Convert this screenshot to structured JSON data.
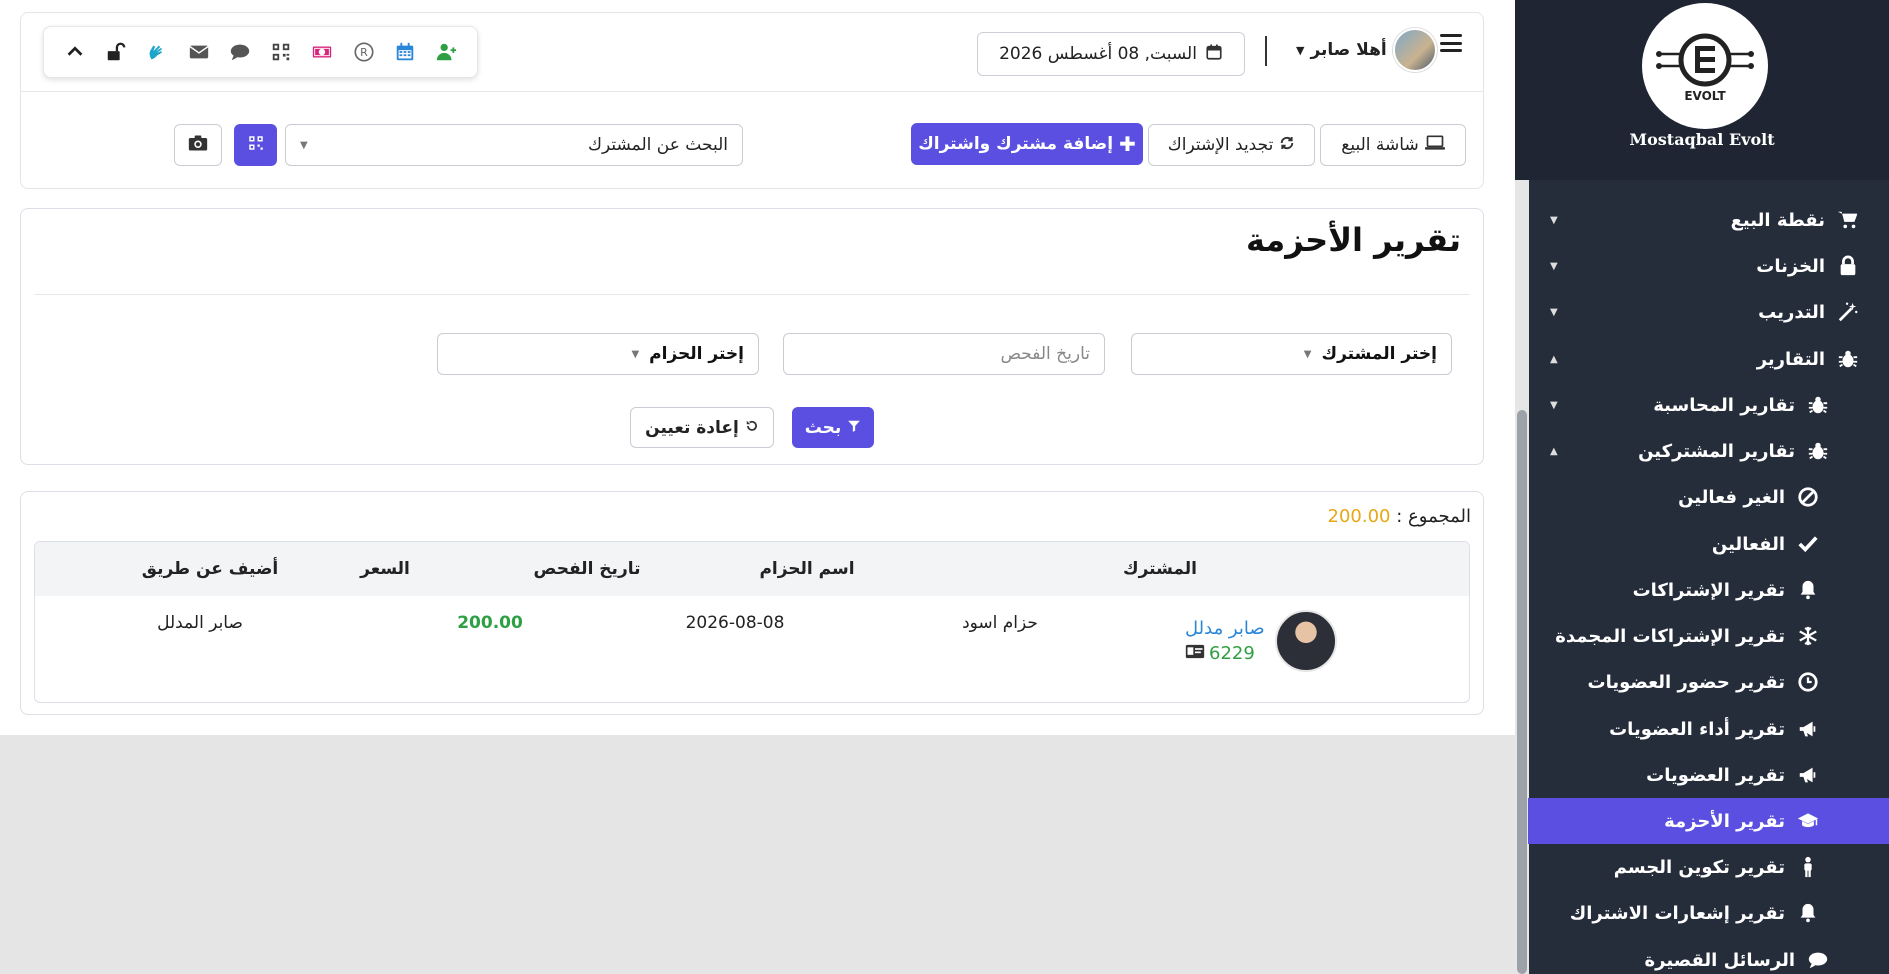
{
  "toolbar": {
    "icons": [
      "add-user-icon",
      "calendar-icon",
      "registered-icon",
      "money-icon",
      "qr-code-icon",
      "chat-icon",
      "envelope-icon",
      "sign-language-icon",
      "unlock-icon",
      "chevron-up-icon"
    ]
  },
  "header": {
    "date": "السبت, 08 أغسطس 2026",
    "user_greeting": "أهلا صابر"
  },
  "actions": {
    "pos_screen": "شاشة البيع",
    "renew_subscription": "تجديد الإشتراك",
    "add_member": "إضافة مشترك واشتراك",
    "search_placeholder": "البحث عن المشترك"
  },
  "report": {
    "title": "تقرير الأحزمة",
    "filters": {
      "member_select": "إختر المشترك",
      "exam_date_placeholder": "تاريخ الفحص",
      "belt_select": "إختر الحزام"
    },
    "search_button": "بحث",
    "reset_button": "إعادة تعيين",
    "total_label": "المجموع :",
    "total_value": "200.00",
    "columns": [
      "المشترك",
      "اسم الحزام",
      "تاريخ الفحص",
      "السعر",
      "أضيف عن طريق"
    ],
    "rows": [
      {
        "member_name": "صابر مدلل",
        "member_id": "6229",
        "belt": "حزام اسود",
        "exam_date": "2026-08-08",
        "price": "200.00",
        "added_by": "صابر المدلل"
      }
    ]
  },
  "sidebar": {
    "brand": "Mostaqbal Evolt",
    "logo_text": "EVOLT",
    "items": [
      {
        "label": "نقطة البيع",
        "icon": "cart-icon"
      },
      {
        "label": "الخزنات",
        "icon": "lock-icon"
      },
      {
        "label": "التدريب",
        "icon": "magic-wand-icon"
      },
      {
        "label": "التقارير",
        "icon": "bug-icon"
      },
      {
        "label": "تقارير المحاسبة",
        "icon": "bug-icon"
      },
      {
        "label": "تقارير المشتركين",
        "icon": "bug-icon"
      },
      {
        "label": "الغير فعالين",
        "icon": "ban-icon"
      },
      {
        "label": "الفعالين",
        "icon": "check-icon"
      },
      {
        "label": "تقرير الإشتراكات",
        "icon": "bell-icon"
      },
      {
        "label": "تقرير الإشتراكات المجمدة",
        "icon": "snowflake-icon"
      },
      {
        "label": "تقرير حضور العضويات",
        "icon": "clock-icon"
      },
      {
        "label": "تقرير أداء العضويات",
        "icon": "megaphone-icon"
      },
      {
        "label": "تقرير العضويات",
        "icon": "megaphone-icon"
      },
      {
        "label": "تقرير الأحزمة",
        "icon": "graduation-cap-icon"
      },
      {
        "label": "تقرير تكوين الجسم",
        "icon": "person-icon"
      },
      {
        "label": "تقرير إشعارات الاشتراك",
        "icon": "bell-icon"
      },
      {
        "label": "الرسائل القصيرة",
        "icon": "comment-icon"
      }
    ]
  },
  "colors": {
    "primary": "#5a4fe0",
    "sidebar_bg": "#252c3a",
    "total_amount": "#e6a817",
    "price": "#2ea043",
    "member_link": "#2a86d8"
  }
}
